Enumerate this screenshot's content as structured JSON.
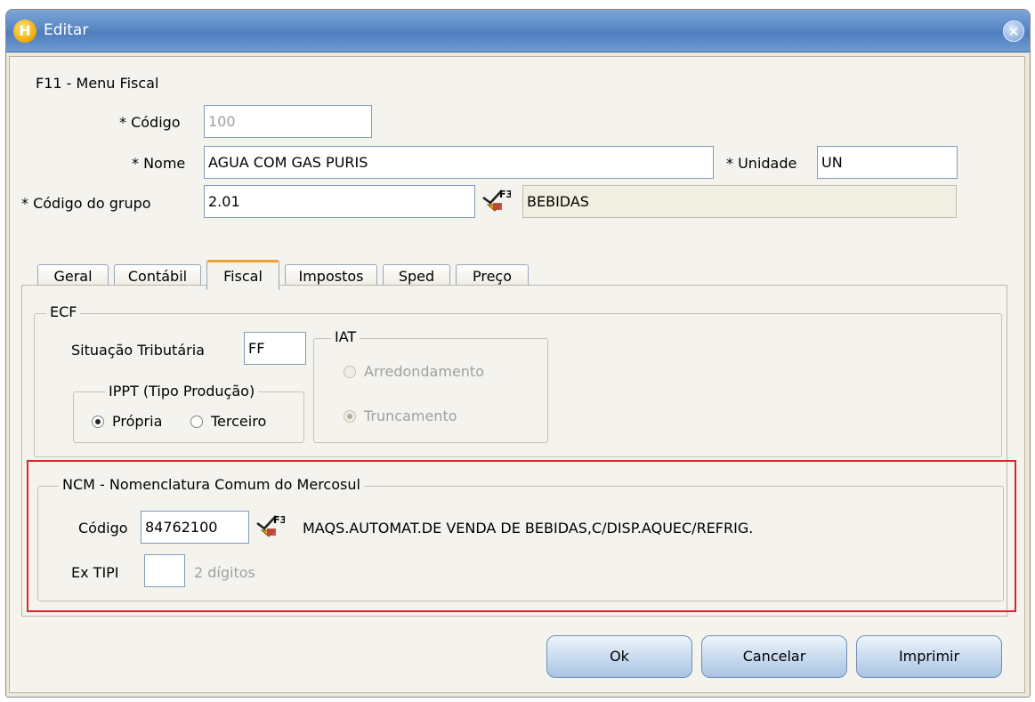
{
  "window": {
    "title": "Editar",
    "close_glyph": "×",
    "app_icon_glyph": "H"
  },
  "header": {
    "section_title": "F11 - Menu Fiscal",
    "codigo_label": "* Código",
    "codigo_value": "100",
    "nome_label": "* Nome",
    "nome_value": "AGUA COM GAS PURIS",
    "unidade_label": "* Unidade",
    "unidade_value": "UN",
    "grupo_label": "* Código do grupo",
    "grupo_value": "2.01",
    "grupo_desc": "BEBIDAS"
  },
  "tabs": [
    {
      "label": "Geral",
      "active": false
    },
    {
      "label": "Contábil",
      "active": false
    },
    {
      "label": "Fiscal",
      "active": true
    },
    {
      "label": "Impostos",
      "active": false
    },
    {
      "label": "Sped",
      "active": false
    },
    {
      "label": "Preço",
      "active": false
    }
  ],
  "ecf": {
    "legend": "ECF",
    "situacao_label": "Situação Tributária",
    "situacao_value": "FF",
    "ippt_legend": "IPPT (Tipo Produção)",
    "propria_label": "Própria",
    "terceiro_label": "Terceiro",
    "iat_legend": "IAT",
    "arredondamento_label": "Arredondamento",
    "truncamento_label": "Truncamento"
  },
  "ncm": {
    "legend": "NCM - Nomenclatura Comum do Mercosul",
    "codigo_label": "Código",
    "codigo_value": "84762100",
    "descricao": "MAQS.AUTOMAT.DE VENDA DE BEBIDAS,C/DISP.AQUEC/REFRIG.",
    "extipi_label": "Ex TIPI",
    "extipi_value": "",
    "extipi_hint": "2 dígitos"
  },
  "buttons": {
    "ok": "Ok",
    "cancelar": "Cancelar",
    "imprimir": "Imprimir"
  },
  "icons": {
    "lookup": "f3-lookup-icon",
    "lookup_key": "F3"
  },
  "colors": {
    "highlight": "#d9262b",
    "active_tab": "#f0a030",
    "titlebar": "#5a88c4"
  }
}
